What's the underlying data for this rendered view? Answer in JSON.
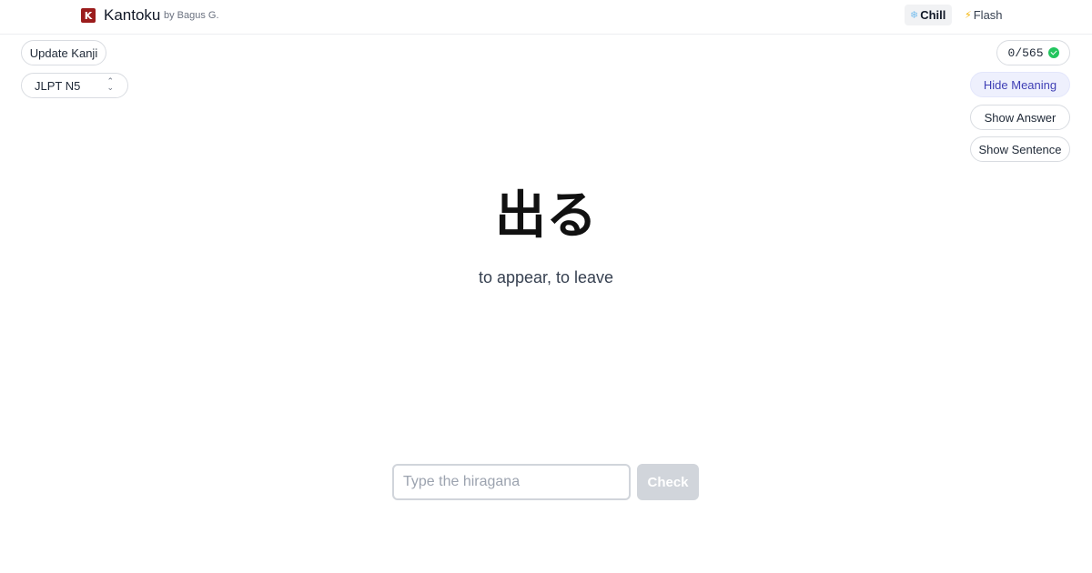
{
  "header": {
    "logo_letter": "K",
    "brand": "Kantoku",
    "byline": "by Bagus G.",
    "modes": [
      {
        "icon": "snowflake-icon",
        "glyph": "❄",
        "label": "Chill",
        "active": true
      },
      {
        "icon": "lightning-icon",
        "glyph": "⚡",
        "label": "Flash",
        "active": false
      }
    ]
  },
  "controls": {
    "update_label": "Update Kanji",
    "level_selected": "JLPT N5",
    "progress": "0/565",
    "hide_meaning_label": "Hide Meaning",
    "show_answer_label": "Show Answer",
    "show_sentence_label": "Show Sentence"
  },
  "card": {
    "word": "出る",
    "meaning": "to appear, to leave"
  },
  "answer": {
    "placeholder": "Type the hiragana",
    "value": "",
    "check_label": "Check"
  },
  "colors": {
    "brand": "#9b1c1c",
    "accent": "#3f3fb5",
    "success": "#22c55e",
    "disabled": "#d1d5db"
  }
}
